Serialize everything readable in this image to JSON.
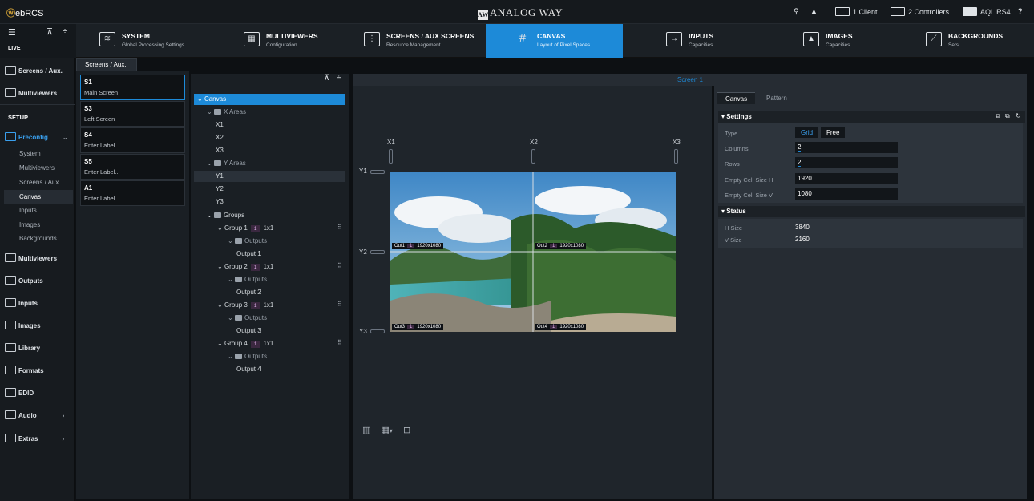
{
  "topbar": {
    "logo_prefix": "ⓦ",
    "logo_name": "ebRCS",
    "brand_mark": "AW",
    "brand": "ANALOG WAY",
    "clients": "1 Client",
    "controllers": "2 Controllers",
    "device": "AQL RS4",
    "search_icon": "search-icon",
    "bell_icon": "bell-icon",
    "help_icon": "help-icon"
  },
  "nav": {
    "tabs": [
      {
        "title": "SYSTEM",
        "sub": "Global Processing Settings",
        "icon": "system-icon"
      },
      {
        "title": "MULTIVIEWERS",
        "sub": "Configuration",
        "icon": "multiviewer-icon"
      },
      {
        "title": "SCREENS / AUX SCREENS",
        "sub": "Resource Management",
        "icon": "screen-icon"
      },
      {
        "title": "CANVAS",
        "sub": "Layout of Pixel Spaces",
        "icon": "canvas-icon"
      },
      {
        "title": "INPUTS",
        "sub": "Capacities",
        "icon": "input-icon"
      },
      {
        "title": "IMAGES",
        "sub": "Capacities",
        "icon": "image-icon"
      },
      {
        "title": "BACKGROUNDS",
        "sub": "Sets",
        "icon": "backgrounds-icon"
      }
    ]
  },
  "sidebar": {
    "live": "LIVE",
    "setup": "SETUP",
    "live_items": [
      "Screens / Aux.",
      "Multiviewers"
    ],
    "preconfig": "Preconfig",
    "preconfig_subs": [
      "System",
      "Multiviewers",
      "Screens / Aux.",
      "Canvas",
      "Inputs",
      "Images",
      "Backgrounds"
    ],
    "items": [
      "Multiviewers",
      "Outputs",
      "Inputs",
      "Images",
      "Library",
      "Formats",
      "EDID",
      "Audio",
      "Extras"
    ]
  },
  "screens": {
    "tab": "Screens / Aux.",
    "cards": [
      {
        "id": "S1",
        "label": "Main Screen"
      },
      {
        "id": "S3",
        "label": "Left Screen"
      },
      {
        "id": "S4",
        "label": "Enter Label..."
      },
      {
        "id": "S5",
        "label": "Enter Label..."
      },
      {
        "id": "A1",
        "label": "Enter Label..."
      }
    ]
  },
  "tree": {
    "canvas": "Canvas",
    "x_areas": "X Areas",
    "x": [
      "X1",
      "X2",
      "X3"
    ],
    "y_areas": "Y Areas",
    "y": [
      "Y1",
      "Y2",
      "Y3"
    ],
    "groups": "Groups",
    "outputs_label": "Outputs",
    "group_list": [
      {
        "name": "Group 1",
        "count": "1",
        "size": "1x1",
        "output": "Output 1"
      },
      {
        "name": "Group 2",
        "count": "1",
        "size": "1x1",
        "output": "Output 2"
      },
      {
        "name": "Group 3",
        "count": "1",
        "size": "1x1",
        "output": "Output 3"
      },
      {
        "name": "Group 4",
        "count": "1",
        "size": "1x1",
        "output": "Output 4"
      }
    ]
  },
  "canvas_view": {
    "title": "Screen 1",
    "x_labels": [
      "X1",
      "X2",
      "X3"
    ],
    "y_labels": [
      "Y1",
      "Y2",
      "Y3"
    ],
    "outputs": [
      {
        "name": "Out1",
        "count": "1",
        "res": "1920x1080"
      },
      {
        "name": "Out2",
        "count": "1",
        "res": "1920x1080"
      },
      {
        "name": "Out3",
        "count": "1",
        "res": "1920x1080"
      },
      {
        "name": "Out4",
        "count": "1",
        "res": "1920x1080"
      }
    ]
  },
  "props": {
    "tabs": [
      "Canvas",
      "Pattern"
    ],
    "settings_title": "Settings",
    "status_title": "Status",
    "type_label": "Type",
    "type_options": [
      "Grid",
      "Free"
    ],
    "rows": [
      {
        "label": "Columns",
        "value": "2"
      },
      {
        "label": "Rows",
        "value": "2"
      },
      {
        "label": "Empty Cell Size H",
        "value": "1920"
      },
      {
        "label": "Empty Cell Size V",
        "value": "1080"
      }
    ],
    "status": [
      {
        "label": "H Size",
        "value": "3840"
      },
      {
        "label": "V Size",
        "value": "2160"
      }
    ],
    "colors": {
      "accent": "#1d8ad8"
    }
  }
}
